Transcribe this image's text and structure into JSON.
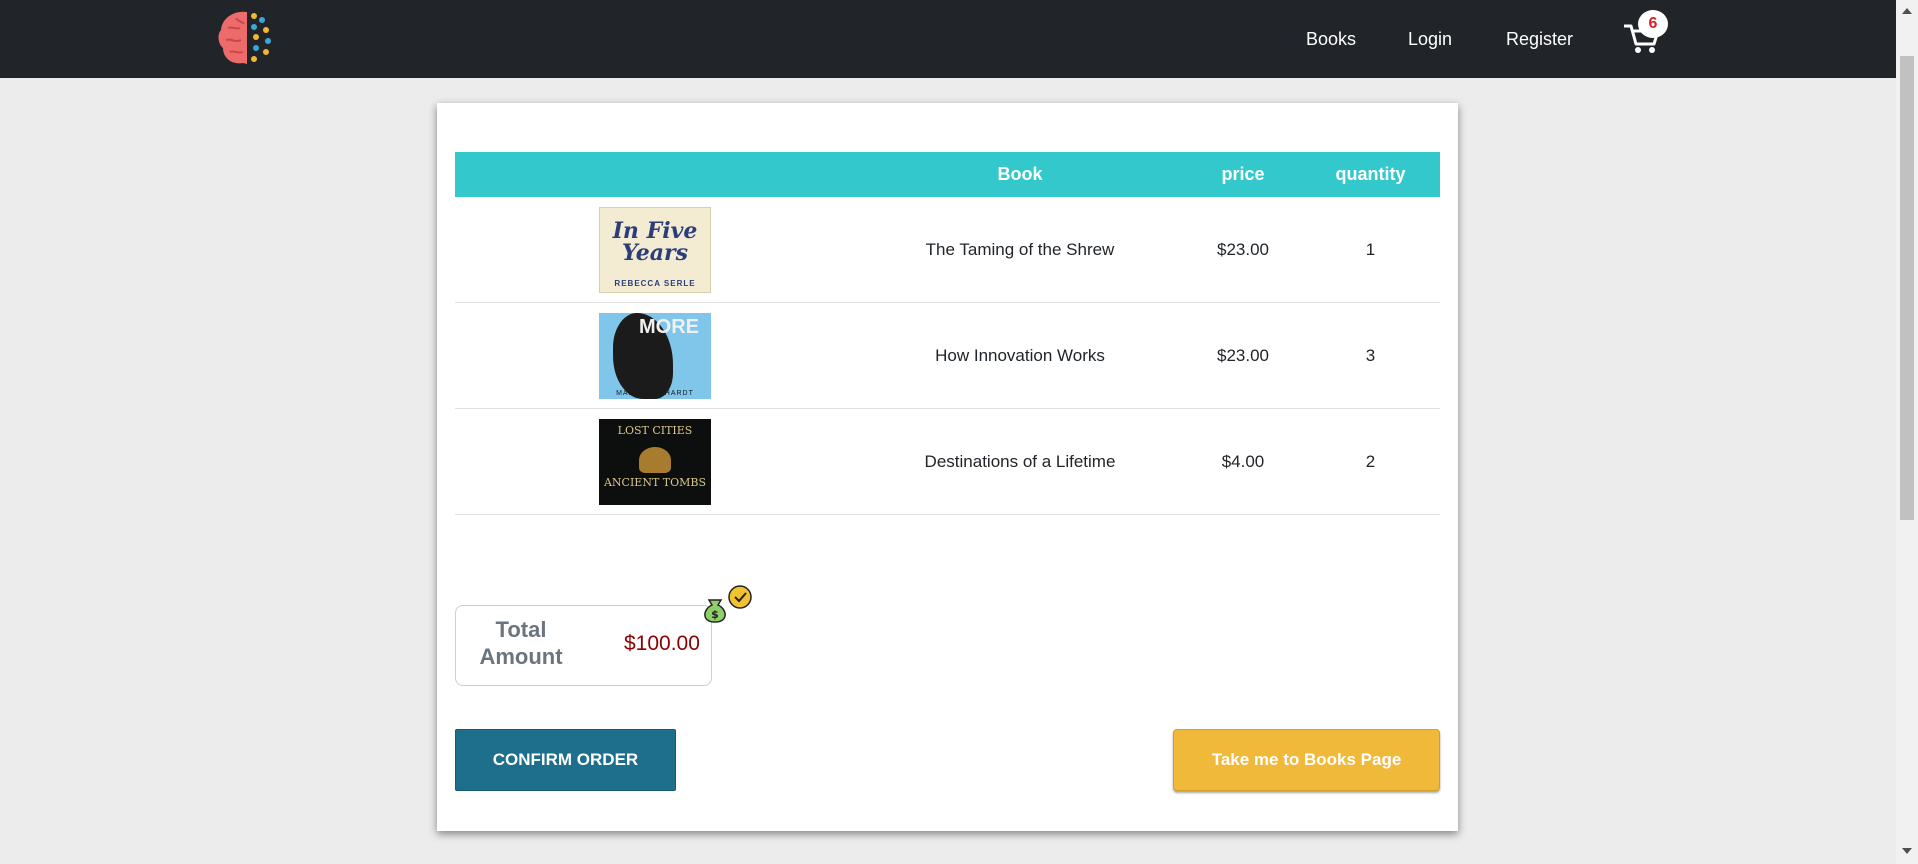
{
  "nav": {
    "links": [
      "Books",
      "Login",
      "Register"
    ],
    "cart_count": "6"
  },
  "table": {
    "headers": [
      "",
      "Book",
      "price",
      "quantity"
    ],
    "rows": [
      {
        "title": "The Taming of the Shrew",
        "price": "$23.00",
        "quantity": "1",
        "cover": {
          "title": "In Five Years",
          "author": "REBECCA SERLE"
        }
      },
      {
        "title": "How Innovation Works",
        "price": "$23.00",
        "quantity": "3",
        "cover": {
          "title": "MORE",
          "author": "MAJKA BURHARDT"
        }
      },
      {
        "title": "Destinations of a Lifetime",
        "price": "$4.00",
        "quantity": "2",
        "cover": {
          "title": "LOST CITIES",
          "subtitle": "ANCIENT TOMBS"
        }
      }
    ]
  },
  "total": {
    "label": "Total Amount",
    "value": "$100.00"
  },
  "buttons": {
    "confirm": "CONFIRM ORDER",
    "books_page": "Take me to Books Page"
  },
  "colors": {
    "navbar": "#212529",
    "table_header": "#33c9cc",
    "confirm_button": "#1d6f8c",
    "books_button": "#f0b93a",
    "total_value": "#8b0000",
    "badge_text": "#dc1f26"
  },
  "icons": {
    "brand": "brain-logo-icon",
    "cart": "shopping-cart-icon",
    "money": "money-bag-icon"
  }
}
